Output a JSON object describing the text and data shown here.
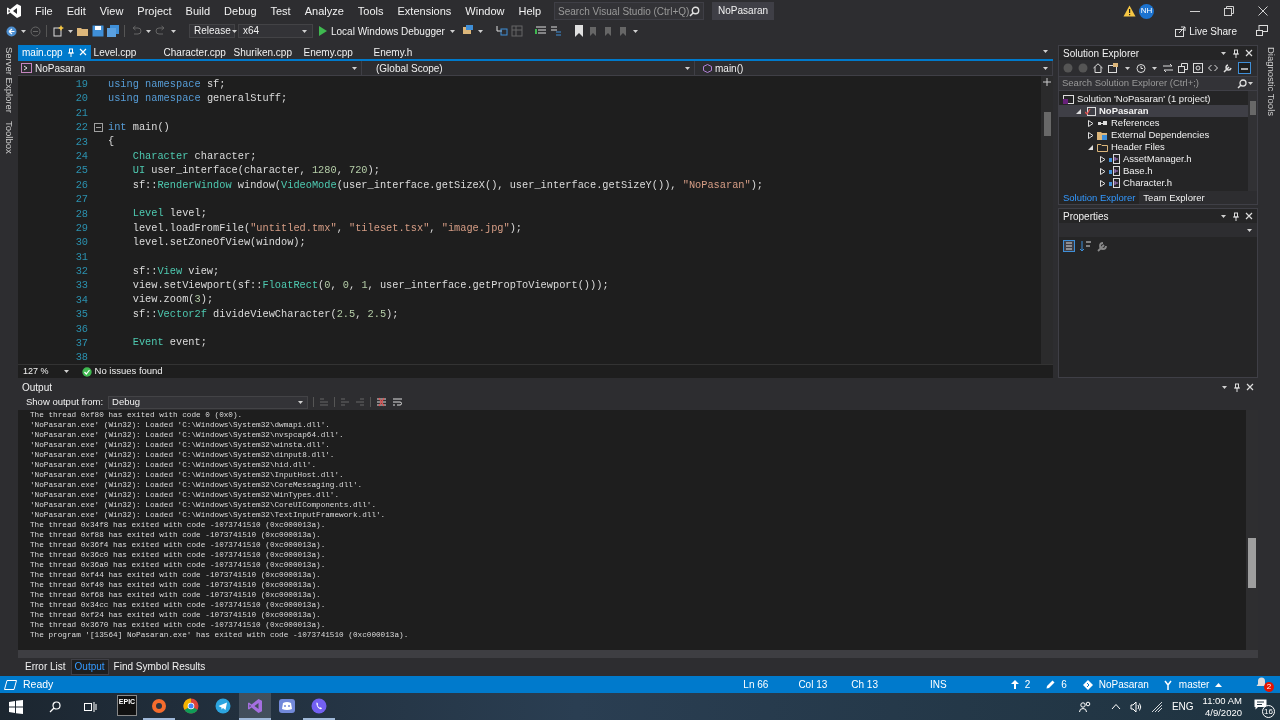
{
  "menu": {
    "items": [
      "File",
      "Edit",
      "View",
      "Project",
      "Build",
      "Debug",
      "Test",
      "Analyze",
      "Tools",
      "Extensions",
      "Window",
      "Help"
    ],
    "search": {
      "placeholder": "Search Visual Studio (Ctrl+Q)"
    },
    "solution_name": "NoPasaran",
    "avatar": "NH"
  },
  "toolbar": {
    "configuration": "Release",
    "platform": "x64",
    "debugger": "Local Windows Debugger",
    "live_share": "Live Share"
  },
  "side_tabs_left": [
    "Server Explorer",
    "Toolbox"
  ],
  "side_tabs_right": [
    "Diagnostic Tools"
  ],
  "document_tabs": [
    {
      "label": "main.cpp",
      "selected": true
    },
    {
      "label": "Level.cpp",
      "selected": false
    },
    {
      "label": "Character.cpp",
      "selected": false
    },
    {
      "label": "Shuriken.cpp",
      "selected": false
    },
    {
      "label": "Enemy.cpp",
      "selected": false
    },
    {
      "label": "Enemy.h",
      "selected": false
    }
  ],
  "navigation": {
    "project": "NoPasaran",
    "scope": "(Global Scope)",
    "member": "main()"
  },
  "editor": {
    "lines": [
      {
        "number": "19",
        "foldable": false,
        "tokens": [
          {
            "kind": "kw",
            "text": "using"
          },
          {
            "kind": "kw",
            "text": " namespace"
          },
          {
            "kind": "text",
            "text": " sf;"
          }
        ]
      },
      {
        "number": "20",
        "foldable": false,
        "tokens": [
          {
            "kind": "kw",
            "text": "using"
          },
          {
            "kind": "kw",
            "text": " namespace"
          },
          {
            "kind": "text",
            "text": " generalStuff;"
          }
        ]
      },
      {
        "number": "21",
        "foldable": false
      },
      {
        "number": "22",
        "foldable": true,
        "tokens": [
          {
            "kind": "kw",
            "text": "int"
          },
          {
            "kind": "text",
            "text": " main()"
          }
        ]
      },
      {
        "number": "23",
        "foldable": false,
        "tokens": [
          {
            "kind": "text",
            "text": "{"
          }
        ]
      },
      {
        "number": "24",
        "foldable": false,
        "tokens": [
          {
            "kind": "type",
            "text": "    Character"
          },
          {
            "kind": "text",
            "text": " character;"
          }
        ]
      },
      {
        "number": "25",
        "foldable": false,
        "tokens": [
          {
            "kind": "type",
            "text": "    UI"
          },
          {
            "kind": "text",
            "text": " user_interface(character, "
          },
          {
            "kind": "num",
            "text": "1280"
          },
          {
            "kind": "text",
            "text": ", "
          },
          {
            "kind": "num",
            "text": "720"
          },
          {
            "kind": "text",
            "text": ");"
          }
        ]
      },
      {
        "number": "26",
        "foldable": false,
        "tokens": [
          {
            "kind": "text",
            "text": "    sf::"
          },
          {
            "kind": "type",
            "text": "RenderWindow"
          },
          {
            "kind": "text",
            "text": " window("
          },
          {
            "kind": "type",
            "text": "VideoMode"
          },
          {
            "kind": "text",
            "text": "(user_interface.getSizeX(), user_interface.getSizeY()), "
          },
          {
            "kind": "str",
            "text": "\"NoPasaran\""
          },
          {
            "kind": "text",
            "text": ");"
          }
        ]
      },
      {
        "number": "27",
        "foldable": false
      },
      {
        "number": "28",
        "foldable": false,
        "tokens": [
          {
            "kind": "type",
            "text": "    Level"
          },
          {
            "kind": "text",
            "text": " level;"
          }
        ]
      },
      {
        "number": "29",
        "foldable": false,
        "tokens": [
          {
            "kind": "text",
            "text": "    level.loadFromFile("
          },
          {
            "kind": "str",
            "text": "\"untitled.tmx\""
          },
          {
            "kind": "text",
            "text": ", "
          },
          {
            "kind": "str",
            "text": "\"tileset.tsx\""
          },
          {
            "kind": "text",
            "text": ", "
          },
          {
            "kind": "str",
            "text": "\"image.jpg\""
          },
          {
            "kind": "text",
            "text": ");"
          }
        ]
      },
      {
        "number": "30",
        "foldable": false,
        "tokens": [
          {
            "kind": "text",
            "text": "    level.setZoneOfView(window);"
          }
        ]
      },
      {
        "number": "31",
        "foldable": false
      },
      {
        "number": "32",
        "foldable": false,
        "tokens": [
          {
            "kind": "text",
            "text": "    sf::"
          },
          {
            "kind": "type",
            "text": "View"
          },
          {
            "kind": "text",
            "text": " view;"
          }
        ]
      },
      {
        "number": "33",
        "foldable": false,
        "tokens": [
          {
            "kind": "text",
            "text": "    view.setViewport(sf::"
          },
          {
            "kind": "type",
            "text": "FloatRect"
          },
          {
            "kind": "text",
            "text": "("
          },
          {
            "kind": "num",
            "text": "0"
          },
          {
            "kind": "text",
            "text": ", "
          },
          {
            "kind": "num",
            "text": "0"
          },
          {
            "kind": "text",
            "text": ", "
          },
          {
            "kind": "num",
            "text": "1"
          },
          {
            "kind": "text",
            "text": ", user_interface.getPropToViewport()));"
          }
        ]
      },
      {
        "number": "34",
        "foldable": false,
        "tokens": [
          {
            "kind": "text",
            "text": "    view.zoom("
          },
          {
            "kind": "num",
            "text": "3"
          },
          {
            "kind": "text",
            "text": ");"
          }
        ]
      },
      {
        "number": "35",
        "foldable": false,
        "tokens": [
          {
            "kind": "text",
            "text": "    sf::"
          },
          {
            "kind": "type",
            "text": "Vector2f"
          },
          {
            "kind": "text",
            "text": " divideViewCharacter("
          },
          {
            "kind": "num",
            "text": "2.5"
          },
          {
            "kind": "text",
            "text": ", "
          },
          {
            "kind": "num",
            "text": "2.5"
          },
          {
            "kind": "text",
            "text": ");"
          }
        ]
      },
      {
        "number": "36",
        "foldable": false
      },
      {
        "number": "37",
        "foldable": false,
        "tokens": [
          {
            "kind": "type",
            "text": "    Event"
          },
          {
            "kind": "text",
            "text": " event;"
          }
        ]
      },
      {
        "number": "38",
        "foldable": false
      }
    ]
  },
  "editor_status": {
    "zoom": "127 %",
    "issues": "No issues found"
  },
  "solution_explorer": {
    "title": "Solution Explorer",
    "search": {
      "placeholder": "Search Solution Explorer (Ctrl+;)"
    },
    "tree": [
      {
        "label": "Solution 'NoPasaran' (1 project)",
        "kind": "solution",
        "selected": false,
        "children": [
          {
            "label": "NoPasaran",
            "kind": "project",
            "expanded": true,
            "selected": true,
            "children": [
              {
                "label": "References",
                "kind": "references",
                "expanded": false,
                "selected": false
              },
              {
                "label": "External Dependencies",
                "kind": "dependencies",
                "expanded": false,
                "selected": false
              },
              {
                "label": "Header Files",
                "kind": "folder",
                "expanded": true,
                "selected": false,
                "children": [
                  {
                    "label": "AssetManager.h",
                    "kind": "file",
                    "expanded": false,
                    "selected": false
                  },
                  {
                    "label": "Base.h",
                    "kind": "file",
                    "expanded": false,
                    "selected": false
                  },
                  {
                    "label": "Character.h",
                    "kind": "file",
                    "expanded": false,
                    "selected": false
                  }
                ]
              }
            ]
          }
        ]
      }
    ],
    "tabs": [
      {
        "label": "Solution Explorer",
        "selected": true
      },
      {
        "label": "Team Explorer",
        "selected": false
      }
    ]
  },
  "properties": {
    "title": "Properties"
  },
  "output": {
    "title": "Output",
    "source_label": "Show output from:",
    "source": "Debug",
    "lines": [
      "The thread 0xf80 has exited with code 0 (0x0).",
      "'NoPasaran.exe' (Win32): Loaded 'C:\\Windows\\System32\\dwmapi.dll'.",
      "'NoPasaran.exe' (Win32): Loaded 'C:\\Windows\\System32\\nvspcap64.dll'.",
      "'NoPasaran.exe' (Win32): Loaded 'C:\\Windows\\System32\\winsta.dll'.",
      "'NoPasaran.exe' (Win32): Loaded 'C:\\Windows\\System32\\dinput8.dll'.",
      "'NoPasaran.exe' (Win32): Loaded 'C:\\Windows\\System32\\hid.dll'.",
      "'NoPasaran.exe' (Win32): Loaded 'C:\\Windows\\System32\\InputHost.dll'.",
      "'NoPasaran.exe' (Win32): Loaded 'C:\\Windows\\System32\\CoreMessaging.dll'.",
      "'NoPasaran.exe' (Win32): Loaded 'C:\\Windows\\System32\\WinTypes.dll'.",
      "'NoPasaran.exe' (Win32): Loaded 'C:\\Windows\\System32\\CoreUIComponents.dll'.",
      "'NoPasaran.exe' (Win32): Loaded 'C:\\Windows\\System32\\TextInputFramework.dll'.",
      "The thread 0x34f8 has exited with code -1073741510 (0xc000013a).",
      "The thread 0xf88 has exited with code -1073741510 (0xc000013a).",
      "The thread 0x36f4 has exited with code -1073741510 (0xc000013a).",
      "The thread 0x36c0 has exited with code -1073741510 (0xc000013a).",
      "The thread 0x36a0 has exited with code -1073741510 (0xc000013a).",
      "The thread 0xf44 has exited with code -1073741510 (0xc000013a).",
      "The thread 0xf40 has exited with code -1073741510 (0xc000013a).",
      "The thread 0xf68 has exited with code -1073741510 (0xc000013a).",
      "The thread 0x34cc has exited with code -1073741510 (0xc000013a).",
      "The thread 0xf24 has exited with code -1073741510 (0xc000013a).",
      "The thread 0x3670 has exited with code -1073741510 (0xc000013a).",
      "The program '[13564] NoPasaran.exe' has exited with code -1073741510 (0xc000013a)."
    ]
  },
  "bottom_tabs": [
    {
      "label": "Error List",
      "selected": false
    },
    {
      "label": "Output",
      "selected": true
    },
    {
      "label": "Find Symbol Results",
      "selected": false
    }
  ],
  "status_bar": {
    "state": "Ready",
    "line": "Ln 66",
    "column": "Col 13",
    "char": "Ch 13",
    "mode": "INS",
    "unpushed": "2",
    "changes": "6",
    "repository": "NoPasaran",
    "branch": "master",
    "notifications": "2"
  },
  "taskbar": {
    "apps": [
      {
        "kind": "epic",
        "text": "EPIC",
        "running": false,
        "selected": false
      },
      {
        "kind": "origin",
        "running": true,
        "selected": false
      },
      {
        "kind": "chrome",
        "running": false,
        "selected": false
      },
      {
        "kind": "telegram",
        "running": false,
        "selected": false
      },
      {
        "kind": "vs",
        "running": true,
        "selected": true
      },
      {
        "kind": "discord",
        "running": false,
        "selected": false
      },
      {
        "kind": "viber",
        "running": true,
        "selected": false
      }
    ],
    "language": "ENG",
    "time": "11:00 AM",
    "date": "4/9/2020",
    "notifications": "16"
  }
}
